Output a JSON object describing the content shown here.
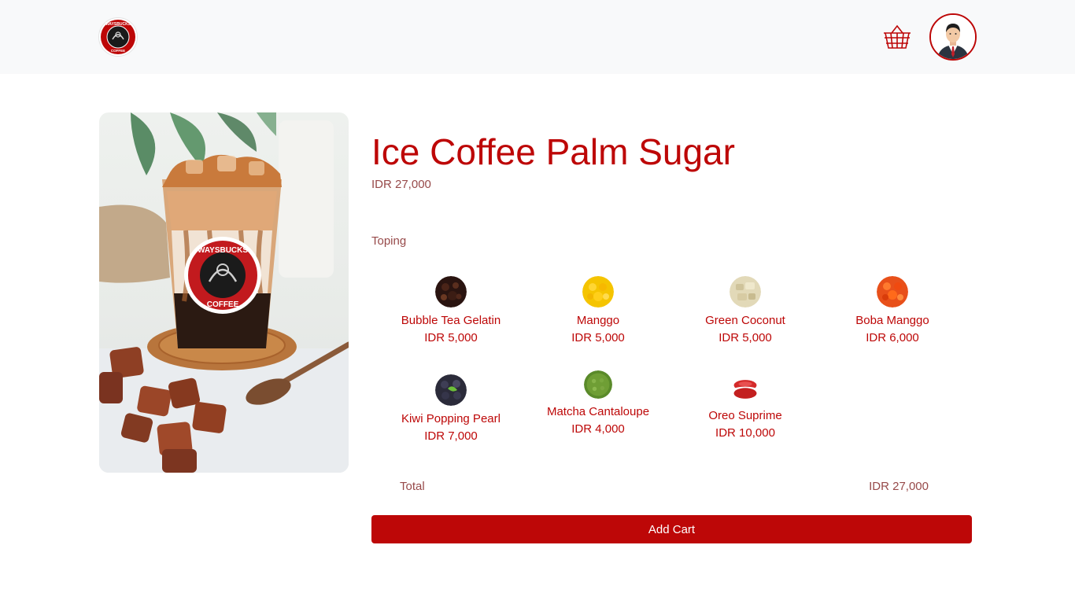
{
  "brand": {
    "logo_top": "WAYSBUCKS",
    "logo_bottom": "COFFEE",
    "accent": "#bd0707"
  },
  "navbar": {
    "cart_icon": "basket-icon",
    "avatar_icon": "user-avatar"
  },
  "product": {
    "title": "Ice Coffee Palm Sugar",
    "price": "IDR 27,000",
    "cup_logo_top": "WAYSBUCKS",
    "cup_logo_bottom": "COFFEE"
  },
  "toping_label": "Toping",
  "toppings": [
    {
      "name": "Bubble Tea Gelatin",
      "price": "IDR 5,000"
    },
    {
      "name": "Manggo",
      "price": "IDR 5,000"
    },
    {
      "name": "Green Coconut",
      "price": "IDR 5,000"
    },
    {
      "name": "Boba Manggo",
      "price": "IDR 6,000"
    },
    {
      "name": "Kiwi Popping Pearl",
      "price": "IDR 7,000"
    },
    {
      "name": "Matcha Cantaloupe",
      "price": "IDR 4,000"
    },
    {
      "name": "Oreo Suprime",
      "price": "IDR 10,000"
    }
  ],
  "total": {
    "label": "Total",
    "value": "IDR 27,000"
  },
  "add_cart_label": "Add Cart"
}
